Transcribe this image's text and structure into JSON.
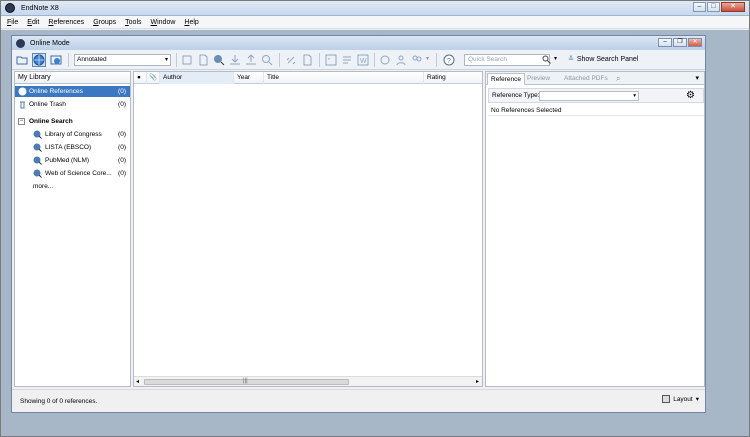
{
  "app": {
    "title": "EndNote X8"
  },
  "menu": [
    "File",
    "Edit",
    "References",
    "Groups",
    "Tools",
    "Window",
    "Help"
  ],
  "window": {
    "title": "Online Mode"
  },
  "toolbar": {
    "style_value": "Annotated",
    "quick_search_placeholder": "Quick Search",
    "show_search_panel": "Show Search Panel"
  },
  "left": {
    "my_library": "My Library",
    "groups": [
      {
        "label": "Online References",
        "count": "(0)",
        "selected": true,
        "icon": "globe-icon"
      },
      {
        "label": "Online Trash",
        "count": "(0)",
        "selected": false,
        "icon": "trash-icon"
      }
    ],
    "online_search_header": "Online Search",
    "searches": [
      {
        "label": "Library of Congress",
        "count": "(0)"
      },
      {
        "label": "LISTA (EBSCO)",
        "count": "(0)"
      },
      {
        "label": "PubMed (NLM)",
        "count": "(0)"
      },
      {
        "label": "Web of Science Core...",
        "count": "(0)"
      }
    ],
    "more": "more..."
  },
  "columns": [
    "Author",
    "Year",
    "Title",
    "Rating"
  ],
  "right": {
    "tabs": [
      "Reference",
      "Preview",
      "Attached PDFs"
    ],
    "reference_type_label": "Reference Type:",
    "no_selection": "No References Selected"
  },
  "status": {
    "text": "Showing 0 of 0 references.",
    "layout": "Layout"
  },
  "colors": {
    "selection": "#3c78c2",
    "mdi_background": "#a8b7c8"
  }
}
